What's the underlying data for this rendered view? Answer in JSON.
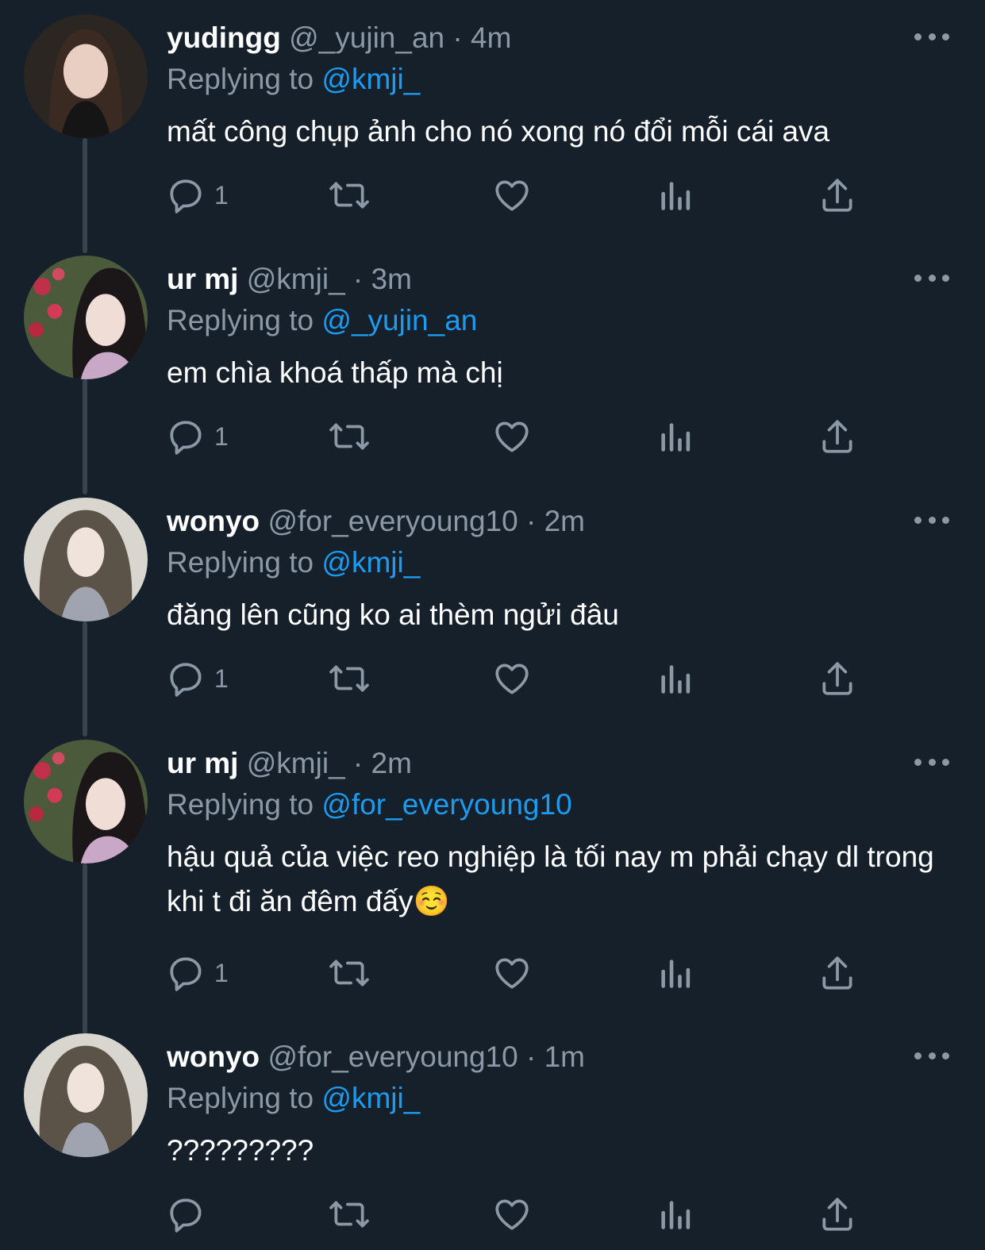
{
  "tweets": [
    {
      "display_name": "yudingg",
      "meta": "@_yujin_an · 4m",
      "replying_prefix": "Replying to",
      "replying_to": "@kmji_",
      "text": "mất công chụp ảnh cho nó xong nó đổi mỗi cái ava",
      "reply_count": "1"
    },
    {
      "display_name": "ur mj",
      "meta": "@kmji_ · 3m",
      "replying_prefix": "Replying to",
      "replying_to": "@_yujin_an",
      "text": "em chìa khoá thấp mà chị",
      "reply_count": "1"
    },
    {
      "display_name": "wonyo",
      "meta": "@for_everyoung10 · 2m",
      "replying_prefix": "Replying to",
      "replying_to": "@kmji_",
      "text": "đăng lên cũng ko ai thèm ngửi đâu",
      "reply_count": "1"
    },
    {
      "display_name": "ur mj",
      "meta": "@kmji_ · 2m",
      "replying_prefix": "Replying to",
      "replying_to": "@for_everyoung10",
      "text": "hậu quả của việc reo nghiệp là tối nay m phải chạy dl trong khi t đi ăn đêm đấy☺️",
      "reply_count": "1"
    },
    {
      "display_name": "wonyo",
      "meta": "@for_everyoung10 · 1m",
      "replying_prefix": "Replying to",
      "replying_to": "@kmji_",
      "text": "?????????",
      "reply_count": ""
    }
  ],
  "icons": {
    "reply": "reply-icon",
    "retweet": "retweet-icon",
    "like": "heart-icon",
    "views": "views-icon",
    "share": "share-icon",
    "more": "more-icon"
  },
  "colors": {
    "background": "#15202b",
    "text": "#ffffff",
    "secondary": "#8b98a5",
    "link": "#1d9bf0",
    "thread_line": "#38444d"
  }
}
